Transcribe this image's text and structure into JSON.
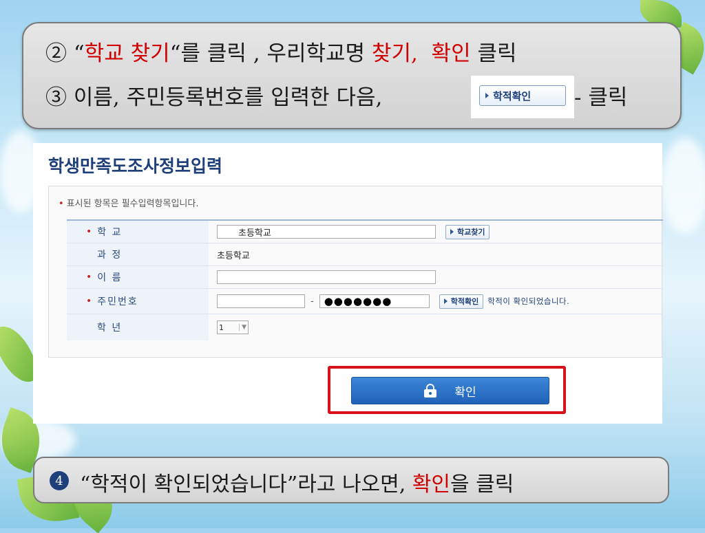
{
  "step2": {
    "prefix": "② “",
    "school_search": "학교 찾기",
    "mid1": "“를 클릭 , 우리학교명 ",
    "find": "찾기,",
    "space": "  ",
    "confirm": "확인",
    "suffix": " 클릭"
  },
  "step3": {
    "text": "③ 이름, 주민등록번호를 입력한 다음,",
    "button_label": "학적확인",
    "suffix": "- 클릭"
  },
  "form": {
    "title": "학생만족도조사정보입력",
    "notice": "표시된 항목은 필수입력항목입니다.",
    "rows": {
      "school": {
        "label": "학 교",
        "value": "초등학교",
        "button": "학교찾기"
      },
      "course": {
        "label": "과 정",
        "value": "초등학교"
      },
      "name": {
        "label": "이 름",
        "value": ""
      },
      "rrn": {
        "label": "주민번호",
        "dash": "-",
        "masked": "●●●●●●●",
        "button": "학적확인",
        "message": "학적이 확인되었습니다."
      },
      "grade": {
        "label": "학 년",
        "value": "1"
      }
    },
    "confirm_button": "확인"
  },
  "step4": {
    "badge": "4",
    "prefix": "“학적이 확인되었습니다”라고 나오면, ",
    "confirm": "확인",
    "suffix": "을 클릭"
  },
  "colors": {
    "highlight_red": "#d00000",
    "confirm_border": "#d6121a",
    "button_blue": "#1f63b8"
  }
}
